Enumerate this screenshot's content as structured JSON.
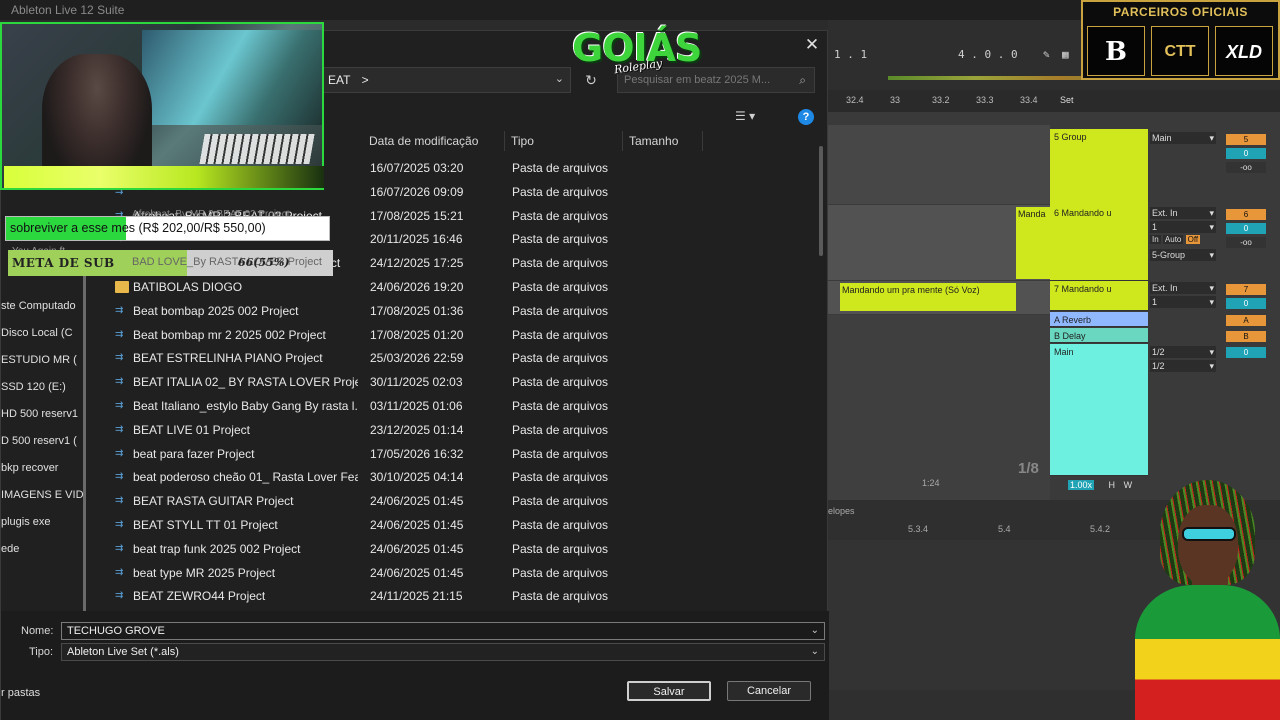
{
  "app_title": "Ableton Live 12 Suite",
  "dialog": {
    "path_crumb": "EAT",
    "path_sep": ">",
    "search_placeholder": "Pesquisar em beatz 2025 M...",
    "columns": [
      "Data de modificação",
      "Tipo",
      "Tamanho"
    ],
    "files": [
      {
        "name": "",
        "date": "16/07/2025 03:20",
        "type": "Pasta de arquivos",
        "kind": "project"
      },
      {
        "name": "",
        "date": "16/07/2026 09:09",
        "type": "Pasta de arquivos",
        "kind": "project"
      },
      {
        "name": "Afrobeat_By MR 2 BEAT 02 Project",
        "date": "17/08/2025 15:21",
        "type": "Pasta de arquivos",
        "kind": "project"
      },
      {
        "name": "",
        "date": "20/11/2025 16:46",
        "type": "Pasta de arquivos",
        "kind": "project"
      },
      {
        "name": "BAD LOVE_By RASTA LOVER Project",
        "date": "24/12/2025 17:25",
        "type": "Pasta de arquivos",
        "kind": "project"
      },
      {
        "name": "BATIBOLAS DIOGO",
        "date": "24/06/2026 19:20",
        "type": "Pasta de arquivos",
        "kind": "folder"
      },
      {
        "name": "Beat bombap 2025 002 Project",
        "date": "17/08/2025 01:36",
        "type": "Pasta de arquivos",
        "kind": "project"
      },
      {
        "name": "Beat bombap mr 2  2025 002 Project",
        "date": "17/08/2025 01:20",
        "type": "Pasta de arquivos",
        "kind": "project"
      },
      {
        "name": "BEAT ESTRELINHA PIANO Project",
        "date": "25/03/2026 22:59",
        "type": "Pasta de arquivos",
        "kind": "project"
      },
      {
        "name": "BEAT ITALIA 02_ BY RASTA LOVER Project",
        "date": "30/11/2025 02:03",
        "type": "Pasta de arquivos",
        "kind": "project"
      },
      {
        "name": "Beat Italiano_estylo Baby Gang  By rasta l...",
        "date": "03/11/2025 01:06",
        "type": "Pasta de arquivos",
        "kind": "project"
      },
      {
        "name": "BEAT LIVE 01 Project",
        "date": "23/12/2025 01:14",
        "type": "Pasta de arquivos",
        "kind": "project"
      },
      {
        "name": "beat para fazer Project",
        "date": "17/05/2026 16:32",
        "type": "Pasta de arquivos",
        "kind": "project"
      },
      {
        "name": "beat poderoso cheão 01_ Rasta Lover Fea...",
        "date": "30/10/2025 04:14",
        "type": "Pasta de arquivos",
        "kind": "project"
      },
      {
        "name": "BEAT RASTA GUITAR Project",
        "date": "24/06/2025 01:45",
        "type": "Pasta de arquivos",
        "kind": "project"
      },
      {
        "name": "BEAT STYLL TT 01 Project",
        "date": "24/06/2025 01:45",
        "type": "Pasta de arquivos",
        "kind": "project"
      },
      {
        "name": "beat trap funk 2025 002 Project",
        "date": "24/06/2025 01:45",
        "type": "Pasta de arquivos",
        "kind": "project"
      },
      {
        "name": "beat type MR 2025 Project",
        "date": "24/06/2025 01:45",
        "type": "Pasta de arquivos",
        "kind": "project"
      },
      {
        "name": "BEAT ZEWRO44 Project",
        "date": "24/11/2025 21:15",
        "type": "Pasta de arquivos",
        "kind": "project"
      }
    ],
    "nav": [
      "ste Computado",
      "Disco Local (C",
      "ESTUDIO MR (",
      "SSD 120 (E:)",
      "HD 500 reserv1",
      "D 500 reserv1 (",
      "bkp recover",
      "IMAGENS E VID",
      "plugis exe",
      "ede"
    ],
    "name_label": "Nome:",
    "name_value": "TECHUGO GROVE",
    "type_label": "Tipo:",
    "type_value": "Ableton Live Set (*.als)",
    "save_label": "Salvar",
    "cancel_label": "Cancelar",
    "hide_folders": "r pastas"
  },
  "overlay": {
    "goal_text": "sobreviver a esse mes (R$ 202,00/R$ 550,00)",
    "goal_fraction": 0.37,
    "sub_text": "META DE SUB",
    "sub_pct": "66(55%)",
    "sub_fraction": 0.55,
    "ghost_you": "You Again ft",
    "logo_main": "GOIÁS",
    "logo_sub": "Roleplay",
    "partners_title": "PARCEIROS OFICIAIS",
    "partner_badges": [
      "B",
      "CTT",
      "XLD"
    ]
  },
  "ableton": {
    "toolbar_pos": "1 . 1",
    "toolbar_pos2": "4 . 0 . 0",
    "ruler": [
      "32.4",
      "33",
      "33.2",
      "33.3",
      "33.4",
      "Set"
    ],
    "tracks": [
      {
        "name": "5 Group",
        "color": "#cfe81e"
      },
      {
        "name": "6 Mandando u",
        "color": "#cfe81e"
      },
      {
        "name": "7 Mandando u",
        "color": "#cfe81e"
      },
      {
        "name": "A Reverb",
        "color": "#8fb8ff"
      },
      {
        "name": "B Delay",
        "color": "#6ad8c0"
      },
      {
        "name": "Main",
        "color": "#6ef0e0"
      }
    ],
    "mix": {
      "main": "Main",
      "ext_in": "Ext. In",
      "ch1": "1",
      "in": "In",
      "auto": "Auto",
      "off": "Off",
      "group": "5-Group",
      "ch12": "1/2"
    },
    "num_vals": [
      "5",
      "0",
      "-oo",
      "6",
      "0",
      "-oo",
      "7",
      "0",
      "-oo",
      "A",
      "B",
      "0"
    ],
    "clip1": "Manda",
    "clip2": "Mandando um pra mente (Só Voz)",
    "fraction_label": "1/8",
    "time_label": "1:24",
    "zoom": "1.00x",
    "hw": [
      "H",
      "W"
    ],
    "envelopes": "elopes",
    "bottom_ruler": [
      "5.3.4",
      "5.4",
      "5.4.2"
    ]
  }
}
